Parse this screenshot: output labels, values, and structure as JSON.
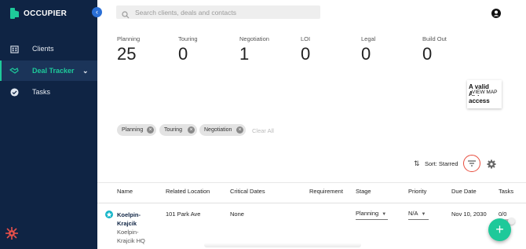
{
  "app": {
    "name": "OCCUPIER"
  },
  "sidebar": {
    "items": [
      {
        "label": "Clients",
        "icon": "building-icon"
      },
      {
        "label": "Deal Tracker",
        "icon": "handshake-icon",
        "active": true
      },
      {
        "label": "Tasks",
        "icon": "check-circle-icon"
      }
    ]
  },
  "search": {
    "placeholder": "Search clients, deals and contacts"
  },
  "stats": [
    {
      "label": "Planning",
      "value": "25"
    },
    {
      "label": "Touring",
      "value": "0"
    },
    {
      "label": "Negotiation",
      "value": "1"
    },
    {
      "label": "LOI",
      "value": "0"
    },
    {
      "label": "Legal",
      "value": "0"
    },
    {
      "label": "Build Out",
      "value": "0"
    }
  ],
  "map": {
    "error_text": "A valid API access",
    "button_label": "VIEW MAP"
  },
  "filters": {
    "chips": [
      "Planning",
      "Touring",
      "Negotiation"
    ],
    "clear_label": "Clear All"
  },
  "sort": {
    "label": "Sort: Starred"
  },
  "table": {
    "headers": [
      "Name",
      "Related Location",
      "Critical Dates",
      "Requirement",
      "Stage",
      "Priority",
      "Due Date",
      "Tasks"
    ],
    "rows": [
      {
        "name": "Koelpin-Krajcik",
        "subname": "Koelpin-Krajcik HQ",
        "location": "101 Park Ave",
        "critical_dates": "None",
        "requirement": "",
        "stage": "Planning",
        "priority": "N/A",
        "due_date": "Nov 10, 2030",
        "tasks": "0/0"
      }
    ]
  },
  "colors": {
    "sidebar": "#0f2444",
    "accent": "#1ec99a",
    "filter_ring": "#e84c3d"
  }
}
